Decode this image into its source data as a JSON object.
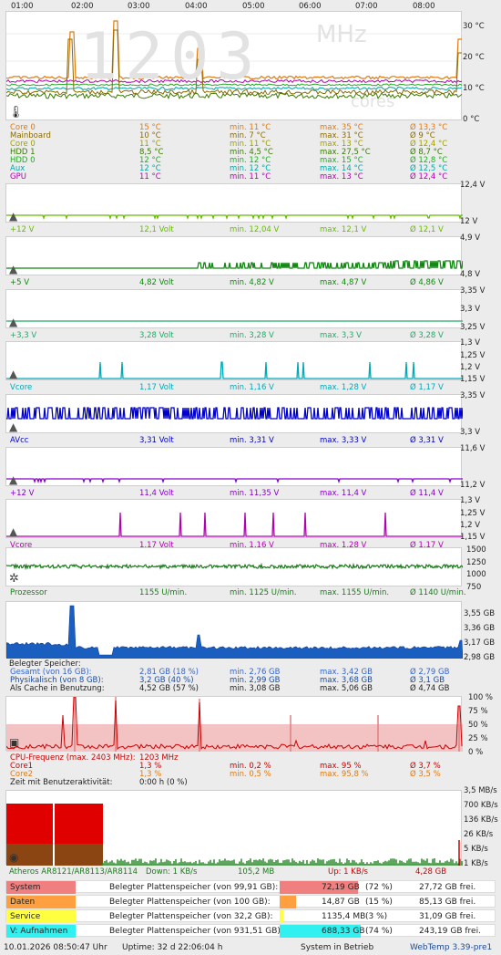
{
  "header": {
    "times": [
      "01:00",
      "02:00",
      "03:00",
      "04:00",
      "05:00",
      "06:00",
      "07:00",
      "08:00"
    ],
    "big": "1203",
    "mhz": "MHz",
    "cores": "cores"
  },
  "temp": {
    "axis": [
      "30 °C",
      "20 °C",
      "10 °C",
      "0 °C"
    ],
    "rows": [
      {
        "name": "Core 0",
        "cur": "15 °C",
        "min": "min. 11 °C",
        "max": "max. 35 °C",
        "avg": "Ø 13,3 °C",
        "color": "#e07a10"
      },
      {
        "name": "Mainboard",
        "cur": "10 °C",
        "min": "min. 7 °C",
        "max": "max. 31 °C",
        "avg": "Ø 9 °C",
        "color": "#8a6a00"
      },
      {
        "name": "Core 0",
        "cur": "11 °C",
        "min": "min. 11 °C",
        "max": "max. 13 °C",
        "avg": "Ø 12,4 °C",
        "color": "#a0a000"
      },
      {
        "name": "HDD 1",
        "cur": "8,5 °C",
        "min": "min. 4,5 °C",
        "max": "max. 27,5 °C",
        "avg": "Ø 8,7 °C",
        "color": "#3a7a00"
      },
      {
        "name": "HDD 0",
        "cur": "12 °C",
        "min": "min. 12 °C",
        "max": "max. 15 °C",
        "avg": "Ø 12,8 °C",
        "color": "#22aa22"
      },
      {
        "name": "Aux",
        "cur": "12 °C",
        "min": "min. 12 °C",
        "max": "max. 14 °C",
        "avg": "Ø 12,5 °C",
        "color": "#00a8a8"
      },
      {
        "name": "GPU",
        "cur": "11 °C",
        "min": "min. 11 °C",
        "max": "max. 13 °C",
        "avg": "Ø 12,4 °C",
        "color": "#b000b0"
      }
    ]
  },
  "volts": [
    {
      "name": "+12 V",
      "cur": "12,1 Volt",
      "min": "min. 12,04 V",
      "max": "max. 12,1 V",
      "avg": "Ø 12,1 V",
      "top": "12,4 V",
      "mid": "",
      "bot": "12 V",
      "color": "#66bb00"
    },
    {
      "name": "+5 V",
      "cur": "4,82 Volt",
      "min": "min. 4,82 V",
      "max": "max. 4,87 V",
      "avg": "Ø 4,86 V",
      "top": "4,9 V",
      "mid": "",
      "bot": "4,8 V",
      "color": "#118811"
    },
    {
      "name": "+3,3 V",
      "cur": "3,28 Volt",
      "min": "min. 3,28 V",
      "max": "max. 3,3 V",
      "avg": "Ø 3,28 V",
      "top": "3,35 V",
      "mid": "3,3 V",
      "bot": "3,25 V",
      "color": "#22aa66"
    },
    {
      "name": "Vcore",
      "cur": "1,17 Volt",
      "min": "min. 1,16 V",
      "max": "max. 1,28 V",
      "avg": "Ø 1,17 V",
      "top": "1,3 V",
      "mid": "1,25 V",
      "mid2": "1,2 V",
      "bot": "1,15 V",
      "color": "#00a8b8"
    },
    {
      "name": "AVcc",
      "cur": "3,31 Volt",
      "min": "min. 3,31 V",
      "max": "max. 3,33 V",
      "avg": "Ø 3,31 V",
      "top": "3,35 V",
      "mid": "",
      "bot": "3,3 V",
      "color": "#0000cc"
    },
    {
      "name": "+12 V",
      "cur": "11,4 Volt",
      "min": "min. 11,35 V",
      "max": "max. 11,4 V",
      "avg": "Ø 11,4 V",
      "top": "11,6 V",
      "mid": "",
      "bot": "11,2 V",
      "color": "#8800cc"
    },
    {
      "name": "Vcore",
      "cur": "1,17 Volt",
      "min": "min. 1,16 V",
      "max": "max. 1,28 V",
      "avg": "Ø 1,17 V",
      "top": "1,3 V",
      "mid": "1,25 V",
      "mid2": "1,2 V",
      "bot": "1,15 V",
      "color": "#b000b0"
    }
  ],
  "fan": {
    "name": "Prozessor",
    "cur": "1155 U/min.",
    "min": "min. 1125 U/min.",
    "max": "max. 1155 U/min.",
    "avg": "Ø 1140 U/min.",
    "axis": [
      "1500",
      "1250",
      "1000",
      "750"
    ],
    "color": "#1a7a1a"
  },
  "mem": {
    "axis": [
      "3,55 GB",
      "3,36 GB",
      "3,17 GB",
      "2,98 GB"
    ],
    "title": "Belegter Speicher:",
    "rows": [
      {
        "name": "Gesamt (von 16 GB):",
        "cur": "2,81 GB (18 %)",
        "min": "min. 2,76 GB",
        "max": "max. 3,42 GB",
        "avg": "Ø 2,79 GB",
        "color": "#3366cc"
      },
      {
        "name": "Physikalisch (von 8 GB):",
        "cur": "3,2 GB (40 %)",
        "min": "min. 2,99 GB",
        "max": "max. 3,68 GB",
        "avg": "Ø 3,1 GB",
        "color": "#1a4a9a"
      },
      {
        "name": "Als Cache in Benutzung:",
        "cur": "4,52 GB (57 %)",
        "min": "min. 3,08 GB",
        "max": "max. 5,06 GB",
        "avg": "Ø 4,74 GB",
        "color": "#222222"
      }
    ]
  },
  "cpu": {
    "axis": [
      "100 %",
      "75 %",
      "50 %",
      "25 %",
      "0 %"
    ],
    "freq_label": "CPU-Frequenz (max. 2403 MHz):",
    "freq": "1203 MHz",
    "rows": [
      {
        "name": "Core1",
        "cur": "1,3 %",
        "min": "min. 0,2 %",
        "max": "max. 95 %",
        "avg": "Ø 3,7 %",
        "color": "#cc0000"
      },
      {
        "name": "Core2",
        "cur": "1,3 %",
        "min": "min. 0,5 %",
        "max": "max. 95,8 %",
        "avg": "Ø 3,5 %",
        "color": "#e07a10"
      }
    ],
    "user_label": "Zeit mit Benutzeraktivität:",
    "user": "0:00 h (0 %)"
  },
  "net": {
    "axis": [
      "3,5 MB/s",
      "700 KB/s",
      "136 KB/s",
      "26 KB/s",
      "5 KB/s",
      "1 KB/s"
    ],
    "name": "Atheros AR8121/AR8113/AR8114",
    "down": "Down: 1 KB/s",
    "downtotal": "105,2 MB",
    "up": "Up: 1 KB/s",
    "uptotal": "4,28 GB"
  },
  "disks": [
    {
      "name": "System",
      "color": "#f08080",
      "label": "Belegter Plattenspeicher (von 99,91 GB):",
      "used": "72,19 GB",
      "pct": "(72 %)",
      "free": "27,72 GB frei.",
      "frac": 0.72
    },
    {
      "name": "Daten",
      "color": "#ffa040",
      "label": "Belegter Plattenspeicher (von 100 GB):",
      "used": "14,87 GB",
      "pct": "(15 %)",
      "free": "85,13 GB frei.",
      "frac": 0.15
    },
    {
      "name": "Service",
      "color": "#ffff40",
      "label": "Belegter Plattenspeicher (von 32,2 GB):",
      "used": "1135,4 MB",
      "pct": "(3 %)",
      "free": "31,09 GB frei.",
      "frac": 0.03
    },
    {
      "name": "V: Aufnahmen",
      "color": "#30f0f0",
      "label": "Belegter Plattenspeicher (von 931,51 GB):",
      "used": "688,33 GB",
      "pct": "(74 %)",
      "free": "243,19 GB frei.",
      "frac": 0.74
    }
  ],
  "footer": {
    "date": "10.01.2026 08:50:47 Uhr",
    "uptime": "Uptime: 32 d 22:06:04 h",
    "status": "System in Betrieb",
    "version": "WebTemp 3.39-pre1"
  }
}
